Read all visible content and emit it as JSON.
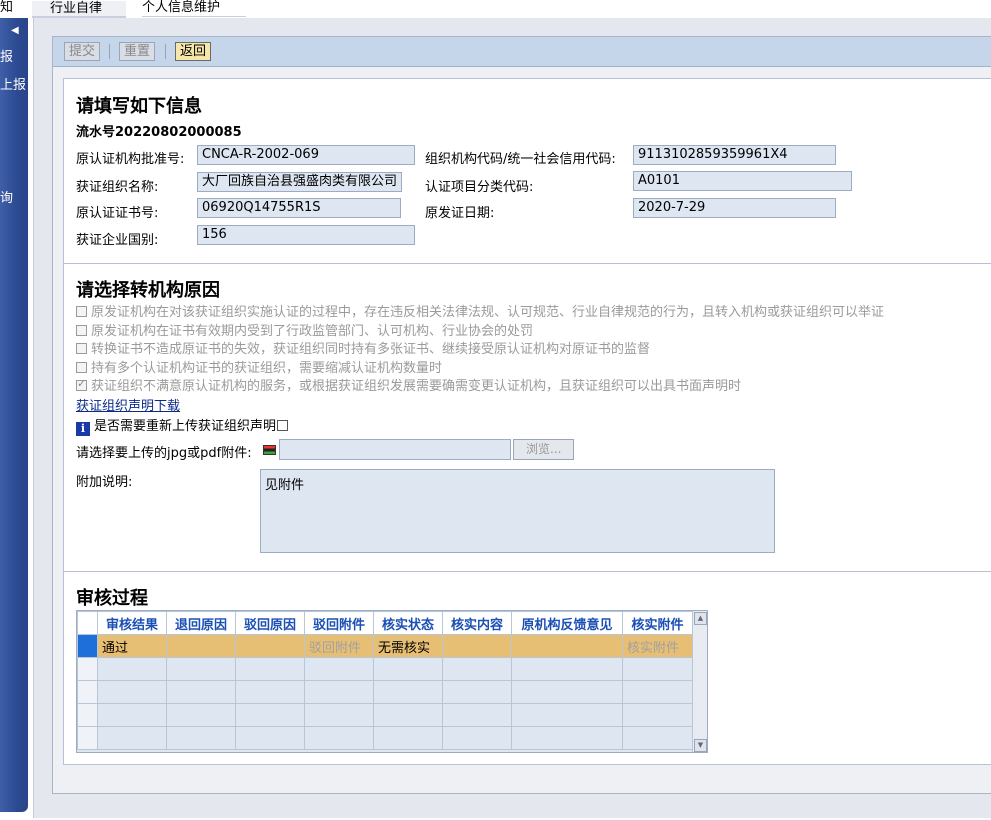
{
  "tabs": {
    "notice": "知",
    "industry": "行业自律",
    "personal": "个人信息维护"
  },
  "sidebar": {
    "item1": "报",
    "item2": "上报",
    "item3": "询"
  },
  "toolbar": {
    "submit": "提交",
    "reset": "重置",
    "back": "返回"
  },
  "section1": {
    "title": "请填写如下信息",
    "serial": "流水号20220802000085",
    "fields": {
      "approval_no_label": "原认证机构批准号:",
      "approval_no": "CNCA-R-2002-069",
      "org_code_label": "组织机构代码/统一社会信用代码:",
      "org_code": "9113102859359961X4",
      "org_name_label": "获证组织名称:",
      "org_name": "大厂回族自治县强盛肉类有限公司",
      "project_code_label": "认证项目分类代码:",
      "project_code": "A0101",
      "cert_no_label": "原认证证书号:",
      "cert_no": "06920Q14755R1S",
      "issue_date_label": "原发证日期:",
      "issue_date": "2020-7-29",
      "country_label": "获证企业国别:",
      "country": "156"
    }
  },
  "section2": {
    "title": "请选择转机构原因",
    "reasons": [
      "原发证机构在对该获证组织实施认证的过程中，存在违反相关法律法规、认可规范、行业自律规范的行为，且转入机构或获证组织可以举证",
      "原发证机构在证书有效期内受到了行政监管部门、认可机构、行业协会的处罚",
      "转换证书不造成原证书的失效，获证组织同时持有多张证书、继续接受原认证机构对原证书的监督",
      "持有多个认证机构证书的获证组织，需要缩减认证机构数量时",
      "获证组织不满意原认证机构的服务，或根据获证组织发展需要确需变更认证机构，且获证组织可以出具书面声明时"
    ],
    "download_link": "获证组织声明下载",
    "reupload_label": "是否需要重新上传获证组织声明",
    "upload_label": "请选择要上传的jpg或pdf附件:",
    "browse": "浏览...",
    "note_label": "附加说明:",
    "note_value": "见附件"
  },
  "section3": {
    "title": "审核过程",
    "columns": [
      "审核结果",
      "退回原因",
      "驳回原因",
      "驳回附件",
      "核实状态",
      "核实内容",
      "原机构反馈意见",
      "核实附件"
    ],
    "rows": [
      [
        "通过",
        "",
        "",
        "驳回附件",
        "无需核实",
        "",
        "",
        "核实附件"
      ]
    ]
  }
}
